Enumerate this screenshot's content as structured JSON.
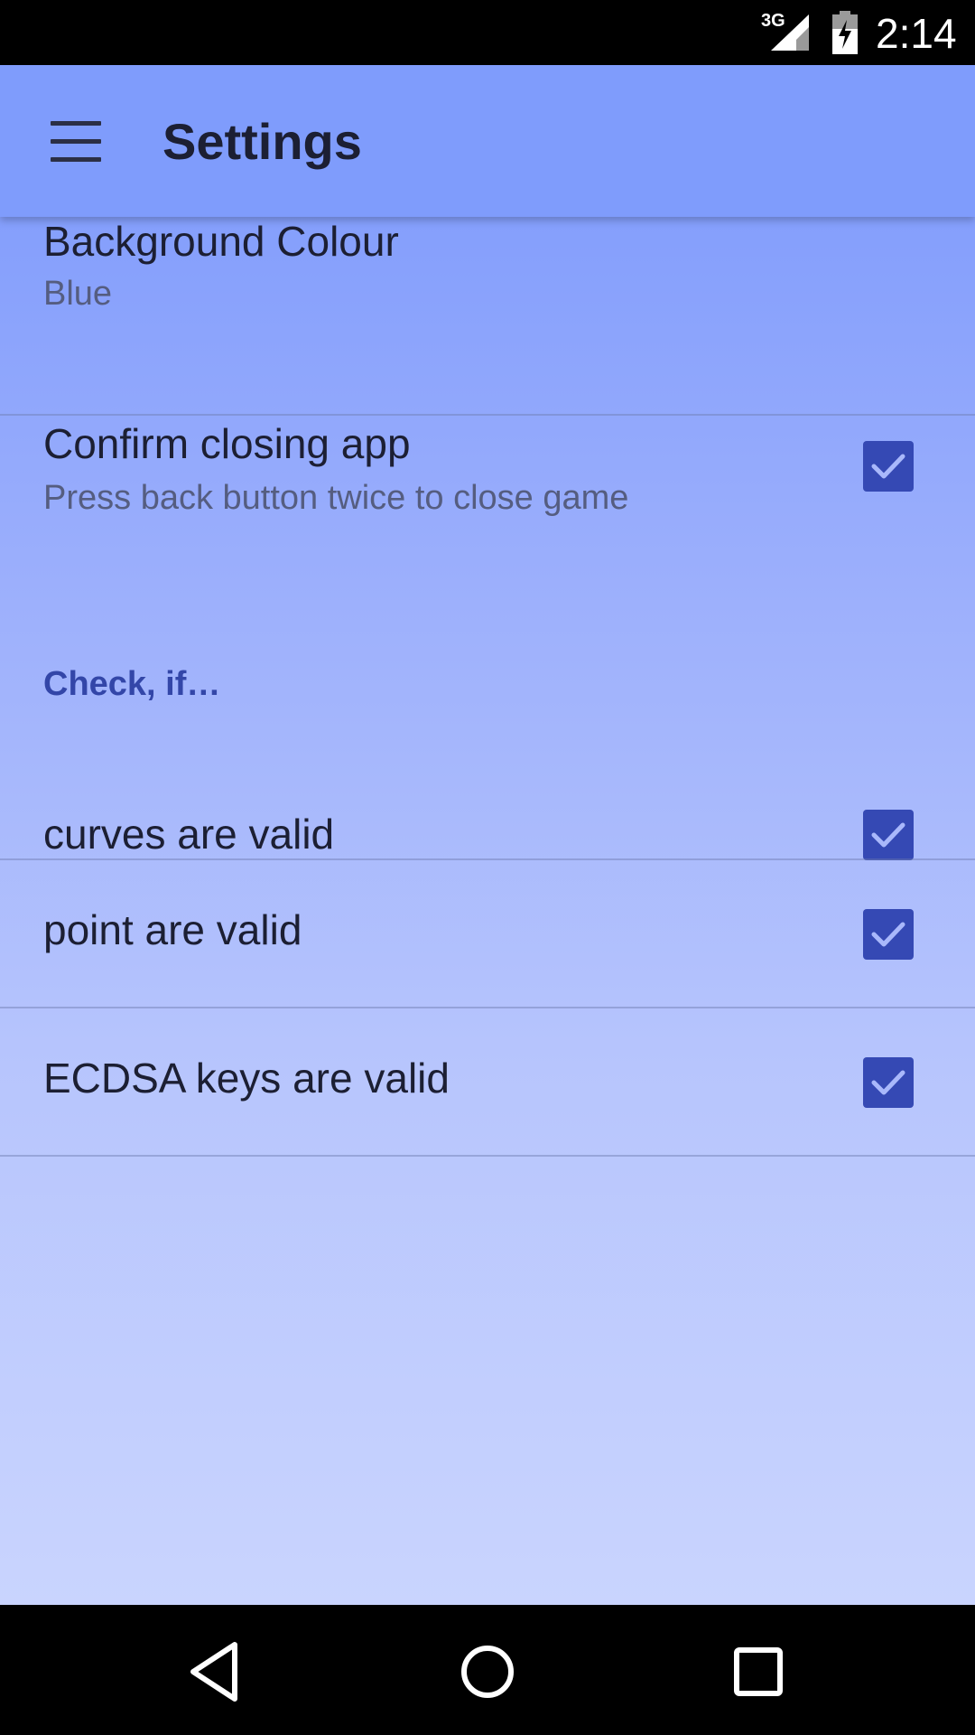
{
  "status_bar": {
    "network": "3G",
    "time": "2:14",
    "icons": [
      "signal-icon",
      "battery-charging-icon"
    ]
  },
  "toolbar": {
    "title": "Settings",
    "menu_icon": "hamburger-menu-icon"
  },
  "preferences": {
    "background_colour": {
      "title": "Background Colour",
      "summary": "Blue"
    },
    "confirm_closing": {
      "title": "Confirm closing app",
      "summary": "Press back button twice to close game",
      "checked": true
    },
    "category": {
      "title": "Check, if…"
    },
    "checks": [
      {
        "title": "curves are valid",
        "checked": true
      },
      {
        "title": "point are valid",
        "checked": true
      },
      {
        "title": "ECDSA keys are valid",
        "checked": true
      }
    ]
  },
  "nav_bar": {
    "buttons": [
      "back-icon",
      "home-icon",
      "recents-icon"
    ]
  },
  "colors": {
    "toolbar": "#7f9cfc",
    "accent": "#3549b4",
    "category_text": "#3346a8"
  }
}
